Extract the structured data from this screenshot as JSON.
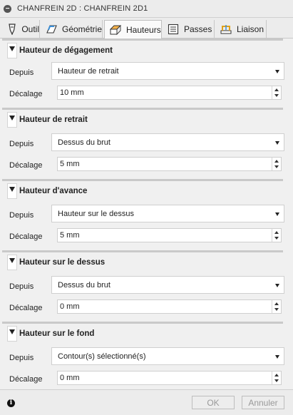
{
  "window": {
    "title": "CHANFREIN 2D : CHANFREIN 2D1"
  },
  "tabs": [
    {
      "label": "Outil",
      "icon": "tool-icon"
    },
    {
      "label": "Géométrie",
      "icon": "geometry-icon"
    },
    {
      "label": "Hauteurs",
      "icon": "heights-icon",
      "active": true
    },
    {
      "label": "Passes",
      "icon": "passes-icon"
    },
    {
      "label": "Liaison",
      "icon": "linking-icon"
    }
  ],
  "groups": [
    {
      "title": "Hauteur de dégagement",
      "from_label": "Depuis",
      "from_value": "Hauteur de retrait",
      "offset_label": "Décalage",
      "offset_value": "10 mm"
    },
    {
      "title": "Hauteur de retrait",
      "from_label": "Depuis",
      "from_value": "Dessus du brut",
      "offset_label": "Décalage",
      "offset_value": "5 mm"
    },
    {
      "title": "Hauteur d'avance",
      "from_label": "Depuis",
      "from_value": "Hauteur sur le dessus",
      "offset_label": "Décalage",
      "offset_value": "5 mm"
    },
    {
      "title": "Hauteur sur le dessus",
      "from_label": "Depuis",
      "from_value": "Dessus du brut",
      "offset_label": "Décalage",
      "offset_value": "0 mm"
    },
    {
      "title": "Hauteur sur le fond",
      "from_label": "Depuis",
      "from_value": "Contour(s) sélectionné(s)",
      "offset_label": "Décalage",
      "offset_value": "0 mm"
    }
  ],
  "footer": {
    "ok_label": "OK",
    "cancel_label": "Annuler"
  },
  "colors": {
    "panel_bg": "#f0f0f0",
    "group_divider": "#c9c9c9",
    "disabled_text": "#999999"
  }
}
